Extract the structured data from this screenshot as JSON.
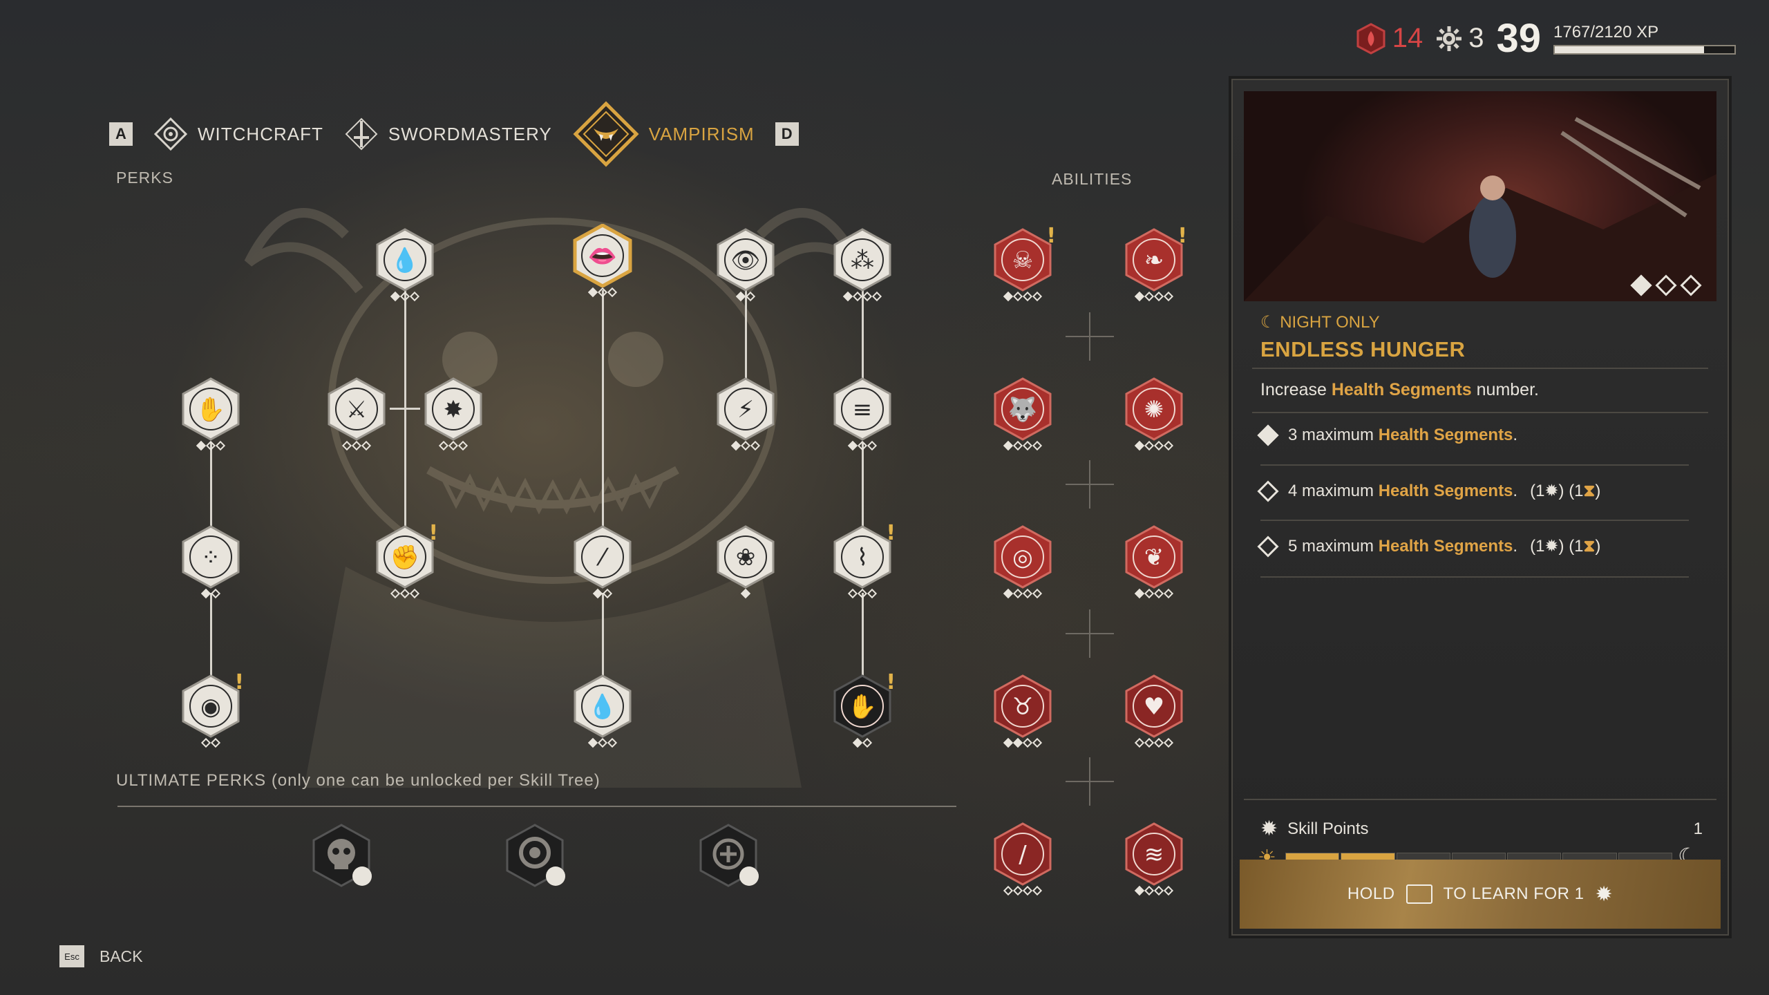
{
  "status": {
    "blood": "14",
    "skill_points": "3",
    "level": "39",
    "xp_text": "1767/2120 XP",
    "xp_progress": 0.83
  },
  "tabs": {
    "prev_key": "A",
    "next_key": "D",
    "items": [
      {
        "label": "WITCHCRAFT",
        "icon": "witchcraft-icon"
      },
      {
        "label": "SWORDMASTERY",
        "icon": "swordmastery-icon"
      },
      {
        "label": "VAMPIRISM",
        "icon": "vampirism-icon",
        "active": true
      }
    ]
  },
  "sections": {
    "perks": "PERKS",
    "abilities": "ABILITIES",
    "ultimate": "ULTIMATE PERKS (only one can be unlocked per Skill Tree)"
  },
  "panel": {
    "tag": "NIGHT ONLY",
    "title": "ENDLESS HUNGER",
    "desc_prefix": "Increase ",
    "desc_hl": "Health Segments",
    "desc_suffix": " number.",
    "levels": [
      {
        "text": "3 maximum ",
        "hl": "Health Segments",
        "end": ".",
        "cost": "",
        "owned": true
      },
      {
        "text": "4 maximum ",
        "hl": "Health Segments",
        "end": ".",
        "cost": "(1 ) (1 )",
        "owned": false
      },
      {
        "text": "5 maximum ",
        "hl": "Health Segments",
        "end": ".",
        "cost": "(1 ) (1 )",
        "owned": false
      }
    ],
    "skill_points_label": "Skill Points",
    "skill_points_value": "1",
    "hold_prefix": "HOLD",
    "hold_suffix": "TO LEARN FOR 1"
  },
  "back": {
    "key": "Esc",
    "label": "BACK"
  },
  "colors": {
    "accent": "#d9a441",
    "blood": "#d64545",
    "ability_red": "#a8302c"
  }
}
